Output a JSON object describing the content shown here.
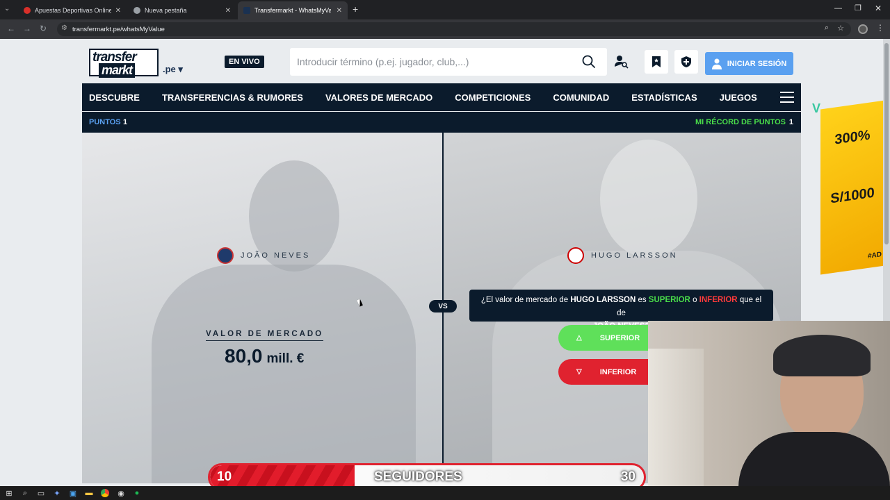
{
  "browser": {
    "tabs": [
      {
        "title": "Apuestas Deportivas Online | A",
        "active": false
      },
      {
        "title": "Nueva pestaña",
        "active": false
      },
      {
        "title": "Transfermarkt - WhatsMyValue",
        "active": true
      }
    ],
    "url": "transfermarkt.pe/whatsMyValue"
  },
  "header": {
    "logo_line1": "transfer",
    "logo_line2": "markt",
    "tld": ".pe ▾",
    "live_badge": "EN VIVO",
    "search_placeholder": "Introducir término (p.ej. jugador, club,...)",
    "login_label": "INICIAR SESIÓN"
  },
  "nav": {
    "items": [
      "DESCUBRE",
      "TRANSFERENCIAS & RUMORES",
      "VALORES DE MERCADO",
      "COMPETICIONES",
      "COMUNIDAD",
      "ESTADÍSTICAS",
      "JUEGOS"
    ]
  },
  "score": {
    "points_label": "PUNTOS",
    "points_value": "1",
    "record_label": "MI RÉCORD DE PUNTOS",
    "record_value": "1"
  },
  "game": {
    "left_player": "JOÃO NEVES",
    "right_player": "HUGO LARSSON",
    "market_value_label": "VALOR DE MERCADO",
    "market_value_number": "80,0",
    "market_value_unit": "mill. €",
    "vs_label": "VS",
    "question": {
      "part1": "¿El valor de mercado de ",
      "player_b": "HUGO LARSSON",
      "part2": " es ",
      "higher": "SUPERIOR",
      "part3": " o ",
      "lower": "INFERIOR",
      "part4": " que el de",
      "player_a": "JOÃO NEVES?"
    },
    "higher_button": "SUPERIOR",
    "lower_button": "INFERIOR"
  },
  "ad": {
    "line1": "300%",
    "line2": "S/1000",
    "line3": "#AD"
  },
  "stream_overlay": {
    "followers_current": "10",
    "followers_label": "SEGUIDORES",
    "followers_goal": "30",
    "progress_fraction": 0.3333
  },
  "colors": {
    "navy": "#0b1b2c",
    "accent_green": "#4ade4a",
    "accent_red": "#e0222f",
    "login_blue": "#5aa0f0"
  }
}
